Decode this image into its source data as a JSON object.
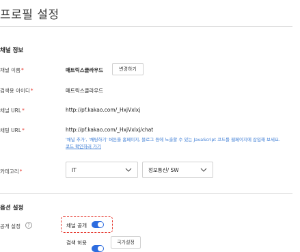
{
  "page": {
    "title": "프로필 설정"
  },
  "channel_info": {
    "section_title": "채널 정보",
    "name": {
      "label": "채널 이름",
      "required_mark": "*",
      "value": "매트릭스클라우드",
      "button": "변경하기"
    },
    "search_id": {
      "label": "검색용 아이디",
      "required_mark": "*",
      "value": "매트릭스클라우드"
    },
    "channel_url": {
      "label": "채널 URL",
      "required_mark": "*",
      "value": "http://pf.kakao.com/_HxjVxlxj"
    },
    "chat_url": {
      "label": "채팅 URL",
      "required_mark": "*",
      "value": "http://pf.kakao.com/_HxjVxlxj/chat",
      "help_text": "'채널 추가', '채팅하기' 버튼을 홈페이지, 블로그 등에 노출할 수 있는 JavaScript 코드를 웹페이지에 삽입해 보세요.",
      "help_link": "코드 확인하러 가기"
    },
    "category": {
      "label": "카테고리",
      "required_mark": "*",
      "primary": "IT",
      "secondary": "정보통신/ SW"
    }
  },
  "options": {
    "section_title": "옵션 설정",
    "public_setting": {
      "label": "공개 설정",
      "help_icon": "question-circle-icon"
    },
    "channel_public": {
      "label": "채널 공개",
      "enabled": true
    },
    "search_allow": {
      "label": "검색 허용",
      "enabled": true,
      "button": "국가설정"
    }
  },
  "colors": {
    "accent": "#2d6cdf",
    "required": "#e5352b",
    "link": "#3a7bd5"
  }
}
